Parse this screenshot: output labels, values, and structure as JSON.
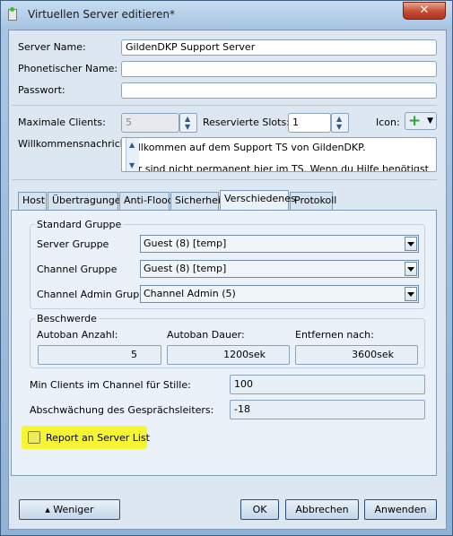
{
  "window": {
    "title": "Virtuellen Server editieren*",
    "close_glyph": "✕"
  },
  "server": {
    "name_label": "Server Name:",
    "name_value": "GildenDKP Support Server",
    "phonetic_label": "Phonetischer Name:",
    "phonetic_value": "",
    "password_label": "Passwort:",
    "password_value": "",
    "max_clients_label": "Maximale Clients:",
    "max_clients_value": "5",
    "reserved_slots_label": "Reservierte Slots:",
    "reserved_slots_value": "1",
    "icon_label": "Icon:",
    "icon_name": "plus-icon",
    "welcome_label": "Willkommensnachricht:",
    "welcome_line1": "Willkommen auf dem Support TS von GildenDKP.",
    "welcome_line2": "Wir sind nicht permanent hier im TS. Wenn du Hilfe benötigst"
  },
  "tabs": [
    {
      "label": "Host",
      "active": false
    },
    {
      "label": "Übertragungen",
      "active": false
    },
    {
      "label": "Anti-Flood",
      "active": false
    },
    {
      "label": "Sicherheit",
      "active": false
    },
    {
      "label": "Verschiedenes",
      "active": true
    },
    {
      "label": "Protokoll",
      "active": false
    }
  ],
  "standard_group": {
    "title": "Standard Gruppe",
    "server_group_label": "Server Gruppe",
    "server_group_value": "Guest (8) [temp]",
    "channel_group_label": "Channel Gruppe",
    "channel_group_value": "Guest (8) [temp]",
    "channel_admin_group_label": "Channel Admin Gruppe",
    "channel_admin_group_value": "Channel Admin (5)"
  },
  "complaint": {
    "title": "Beschwerde",
    "autoban_count_label": "Autoban Anzahl:",
    "autoban_count_value": "5",
    "autoban_duration_label": "Autoban Dauer:",
    "autoban_duration_value": "1200sek",
    "remove_after_label": "Entfernen nach:",
    "remove_after_value": "3600sek"
  },
  "misc": {
    "min_clients_label": "Min Clients im Channel für Stille:",
    "min_clients_value": "100",
    "attenuation_label": "Abschwächung des Gesprächsleiters:",
    "attenuation_value": "-18",
    "report_label": "Report an Server List",
    "report_checked": false,
    "highlight_color": "#f5f533"
  },
  "buttons": {
    "less": "Weniger",
    "less_icon": "chevron-up-icon",
    "ok": "OK",
    "cancel": "Abbrechen",
    "apply": "Anwenden"
  }
}
